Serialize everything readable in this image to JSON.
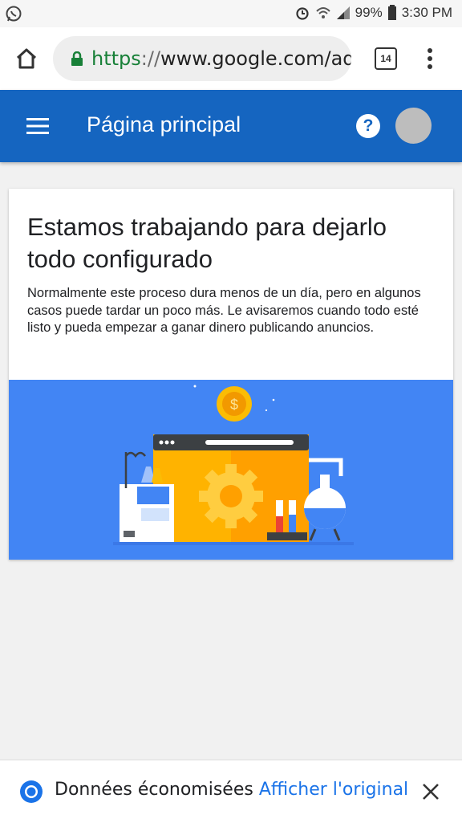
{
  "status_bar": {
    "battery": "99%",
    "time": "3:30 PM"
  },
  "browser": {
    "url_scheme": "https",
    "url_separator": "://",
    "url_rest": "www.google.com/ad",
    "tab_count": "14"
  },
  "app_bar": {
    "title": "Página principal",
    "help_label": "?"
  },
  "card": {
    "heading": "Estamos trabajando para dejarlo todo configurado",
    "body": "Normalmente este proceso dura menos de un día, pero en algunos casos puede tardar un poco más. Le avisaremos cuando todo esté listo y pueda empezar a ganar dinero publicando anuncios."
  },
  "data_saver": {
    "message": "Données économisées",
    "action": "Afficher l'original"
  },
  "colors": {
    "app_bar": "#1565c0",
    "illustration_bg": "#4285f4",
    "link": "#1a73e8",
    "lock": "#188038"
  }
}
